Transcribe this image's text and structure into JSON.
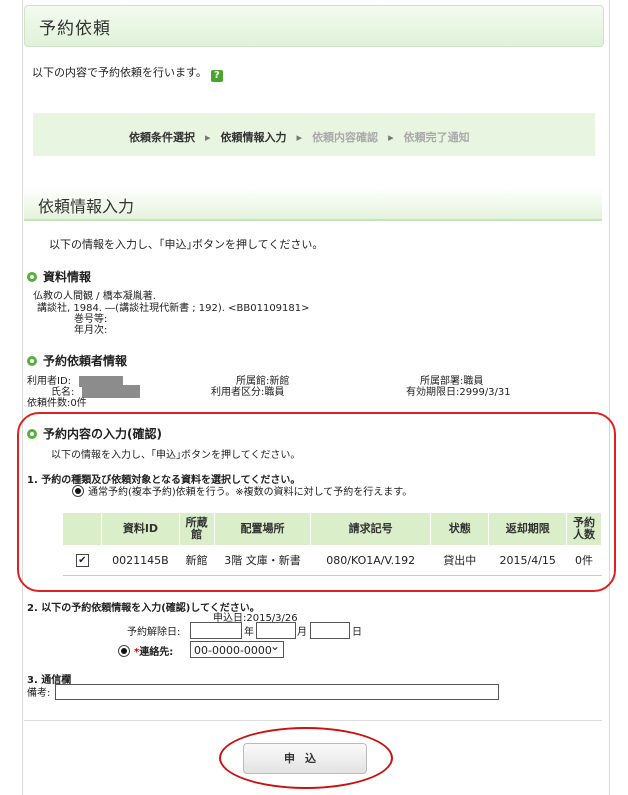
{
  "page_title": "予約依頼",
  "intro": "以下の内容で予約依頼を行います。",
  "help_icon": "?",
  "steps": [
    {
      "label": "依頼条件選択",
      "active": true
    },
    {
      "label": "依頼情報入力",
      "active": true
    },
    {
      "label": "依頼内容確認",
      "active": false
    },
    {
      "label": "依頼完了通知",
      "active": false
    }
  ],
  "step_arrow": "▸",
  "section_title": "依頼情報入力",
  "section_intro": "以下の情報を入力し、｢申込｣ボタンを押してください。",
  "material": {
    "heading": "資料情報",
    "line1": "仏教の人間観 / 橋本凝胤著.",
    "line2": "講談社, 1984. ―(講談社現代新書 ; 192). <BB01109181>",
    "line3": "巻号等:",
    "line4": "年月次:"
  },
  "requester": {
    "heading": "予約依頼者情報",
    "user_id_label": "利用者ID:",
    "name_label": "氏名:",
    "count_label": "依頼件数:0件",
    "library": "所属館:新館",
    "user_type": "利用者区分:職員",
    "dept": "所属部署:職員",
    "expiry": "有効期限日:2999/3/31"
  },
  "reserve": {
    "heading": "予約内容の入力(確認)",
    "intro": "以下の情報を入力し、｢申込｣ボタンを押してください。",
    "step1": "1. 予約の種類及び依頼対象となる資料を選択してください。",
    "option": "通常予約(複本予約)依頼を行う。※複数の資料に対して予約を行えます。",
    "columns": [
      "資料ID",
      "所蔵館",
      "配置場所",
      "請求記号",
      "状態",
      "返却期限",
      "予約人数"
    ],
    "rows": [
      {
        "checked": "✔",
        "id": "0021145B",
        "lib": "新館",
        "loc": "3階 文庫・新書",
        "call": "080/KO1A/V.192",
        "status": "貸出中",
        "due": "2015/4/15",
        "count": "0件"
      }
    ]
  },
  "step2": {
    "heading": "2. 以下の予約依頼情報を入力(確認)してください。",
    "apply_date": "申込日:2015/3/26",
    "cancel_label": "予約解除日:",
    "year": "年",
    "month": "月",
    "day": "日",
    "contact_required": "*",
    "contact_label": "連絡先:",
    "contact_value": "00-0000-0000"
  },
  "step3": {
    "heading": "3. 通信欄",
    "memo_label": "備考:"
  },
  "submit_label": "申込",
  "colors": {
    "accent_green": "#58b03f",
    "highlight_red": "#d22"
  }
}
